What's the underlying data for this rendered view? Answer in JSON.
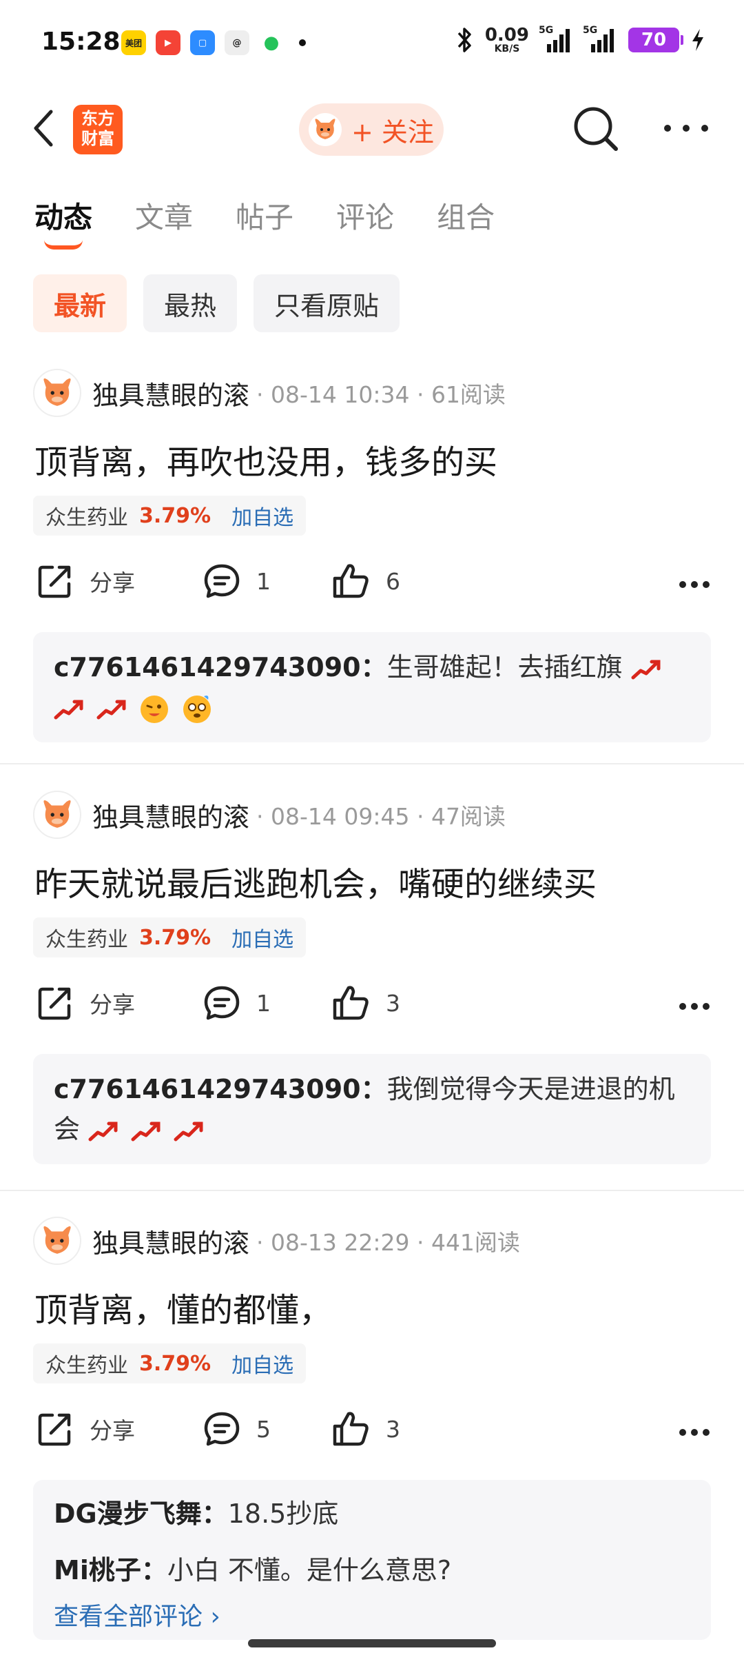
{
  "status_bar": {
    "time": "15:28",
    "apps": [
      {
        "name": "meituan",
        "label": "美团",
        "color": "#ffd100",
        "text_color": "#222"
      },
      {
        "name": "video",
        "label": "▶",
        "color": "#f44336",
        "text_color": "#fff"
      },
      {
        "name": "blue-app",
        "label": "▢",
        "color": "#2d8cff",
        "text_color": "#fff"
      },
      {
        "name": "threads",
        "label": "@",
        "color": "#eeeeee",
        "text_color": "#222"
      },
      {
        "name": "chat",
        "label": "●",
        "color": "#ffffff",
        "text_color": "#25c35a"
      }
    ],
    "net_speed": "0.09",
    "net_speed_unit": "KB/S",
    "signal1_tag": "5G",
    "signal2_tag": "5G",
    "battery": "70"
  },
  "header": {
    "logo_line1": "东方",
    "logo_line2": "财富",
    "follow_label": "+ 关注"
  },
  "tabs": [
    "动态",
    "文章",
    "帖子",
    "评论",
    "组合"
  ],
  "filters": [
    "最新",
    "最热",
    "只看原贴"
  ],
  "posts": [
    {
      "author": "独具慧眼的滚",
      "meta": "· 08-14 10:34 · 61阅读",
      "body": "顶背离，再吹也没用，钱多的买",
      "stock": "众生药业",
      "change": "3.79%",
      "add": "加自选",
      "share": "分享",
      "comments": "1",
      "likes": "6",
      "replies": [
        {
          "user": "c7761461429743090：",
          "text": "生哥雄起！去插红旗"
        }
      ]
    },
    {
      "author": "独具慧眼的滚",
      "meta": "· 08-14 09:45 · 47阅读",
      "body": "昨天就说最后逃跑机会，嘴硬的继续买",
      "stock": "众生药业",
      "change": "3.79%",
      "add": "加自选",
      "share": "分享",
      "comments": "1",
      "likes": "3",
      "replies": [
        {
          "user": "c7761461429743090：",
          "text": "我倒觉得今天是进退的机会"
        }
      ]
    },
    {
      "author": "独具慧眼的滚",
      "meta": "· 08-13 22:29 · 441阅读",
      "body": "顶背离，懂的都懂，",
      "stock": "众生药业",
      "change": "3.79%",
      "add": "加自选",
      "share": "分享",
      "comments": "5",
      "likes": "3",
      "replies": [
        {
          "user": "DG漫步飞舞：",
          "text": "18.5抄底"
        },
        {
          "user": "Mi桃子：",
          "text": "小白 不懂。是什么意思?"
        }
      ],
      "view_all": "查看全部评论 ›"
    }
  ],
  "colors": {
    "accent": "#f25325",
    "up": "#e0401c",
    "link": "#2a6db5"
  }
}
